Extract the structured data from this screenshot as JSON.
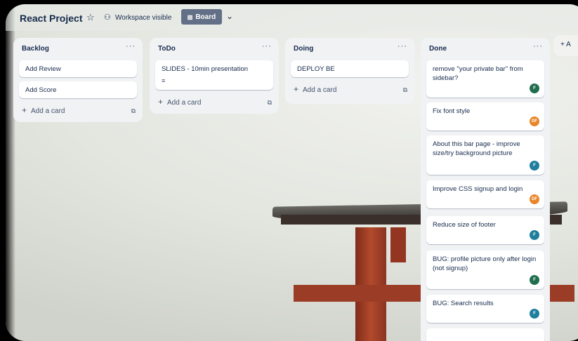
{
  "header": {
    "title": "React Project",
    "star_icon": "☆",
    "visibility_icon": "⚇",
    "visibility_label": "Workspace visible",
    "board_icon": "▥",
    "board_label": "Board",
    "chevron": "⌄"
  },
  "lists": [
    {
      "name": "Backlog",
      "more": "···",
      "cards": [
        {
          "text": "Add Review"
        },
        {
          "text": "Add Score"
        }
      ],
      "add_label": "Add a card"
    },
    {
      "name": "ToDo",
      "more": "···",
      "cards": [
        {
          "text": "SLIDES - 10min presentation",
          "desc_icon": "≡"
        }
      ],
      "add_label": "Add a card"
    },
    {
      "name": "Doing",
      "more": "···",
      "cards": [
        {
          "text": "DEPLOY BE"
        }
      ],
      "add_label": "Add a card"
    },
    {
      "name": "Done",
      "more": "···",
      "cards": [
        {
          "text": "remove \"your private bar\" from sidebar?",
          "avatar": "F",
          "avatar_color": "#216e4e"
        },
        {
          "text": "Fix font style",
          "avatar": "DF",
          "avatar_color": "#e8862a"
        },
        {
          "text": "About this bar page - improve size/try background picture",
          "avatar": "F",
          "avatar_color": "#1d7f9c"
        },
        {
          "text": "Improve CSS signup and login",
          "avatar": "DF",
          "avatar_color": "#e8862a"
        },
        {
          "text": "Reduce size of footer",
          "avatar": "F",
          "avatar_color": "#1d7f9c"
        },
        {
          "text": "BUG: profile picture only after login (not signup)",
          "avatar": "F",
          "avatar_color": "#216e4e"
        },
        {
          "text": "BUG: Search results",
          "avatar": "F",
          "avatar_color": "#1d7f9c"
        }
      ]
    }
  ],
  "add_list_label": "+ A",
  "add_symbol": "+",
  "template_icon": "⧉"
}
